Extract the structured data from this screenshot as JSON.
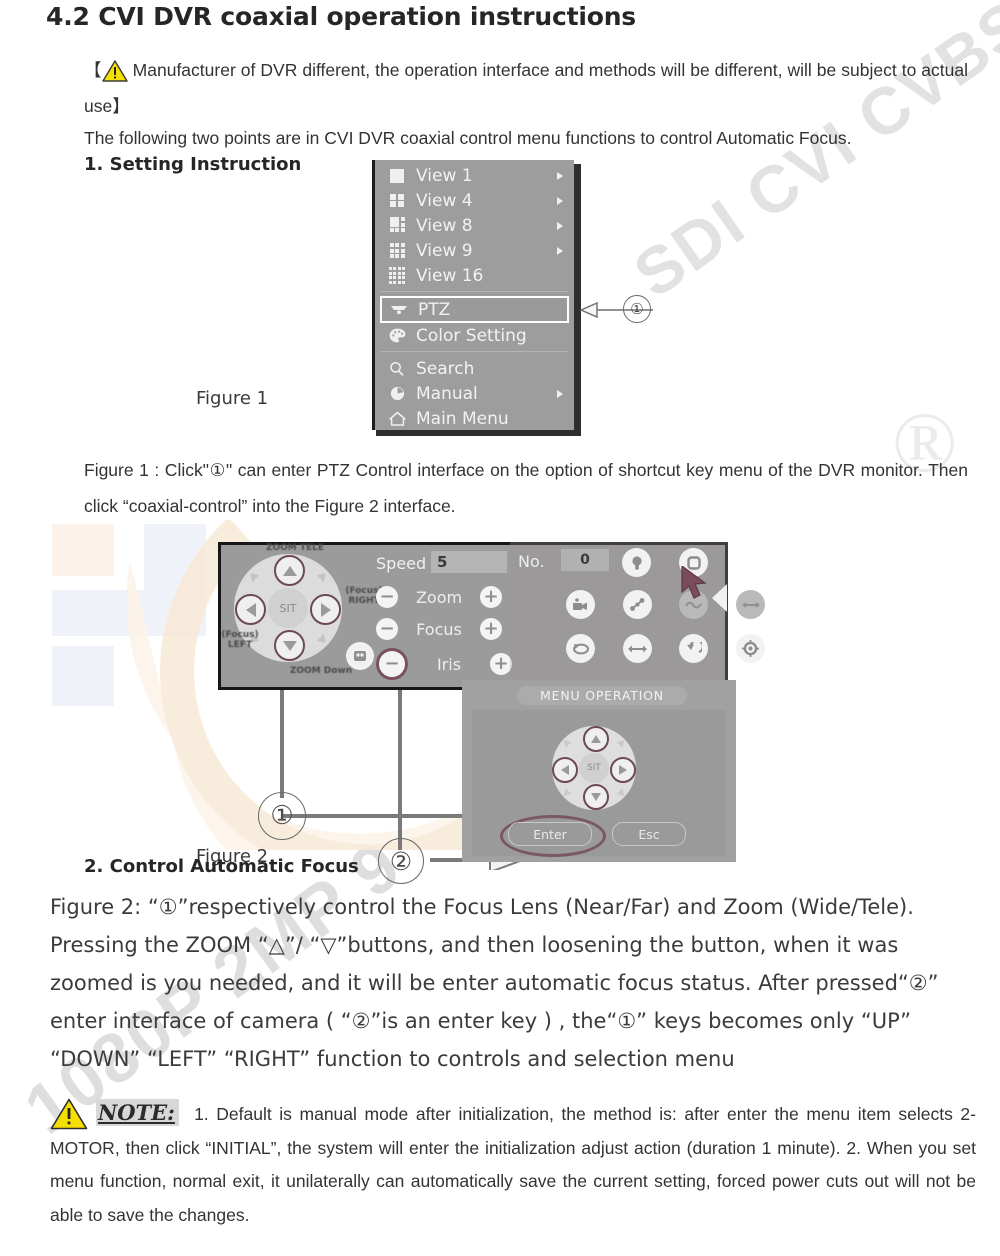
{
  "document": {
    "title": "4.2 CVI DVR coaxial operation instructions",
    "warning_note": "Manufacturer of DVR different,   the operation interface and methods will be different, will be subject to actual use",
    "warning_bracket_open": "【",
    "warning_bracket_close": "】",
    "intro": "The following two points are in CVI DVR coaxial control menu functions to control Automatic Focus.",
    "section_1_heading": "1.  Setting Instruction",
    "section_2_heading": "2.  Control Automatic Focus",
    "figure1_caption": "Figure 1",
    "figure2_caption": "Figure 2",
    "figure1_description": "Figure 1 : Click\"①\" can enter PTZ Control interface on the option of shortcut key menu of the DVR monitor. Then click “coaxial-control” into the Figure 2 interface.",
    "body_paragraph": "Figure 2:  “①”respectively control the Focus Lens (Near/Far) and Zoom (Wide/Tele). Pressing the ZOOM “△”/ “▽”buttons, and then loosening the button, when it was zoomed is you needed, and it will be enter automatic focus status. After pressed“②” enter interface of camera ( “②”is an enter key ) , the“①” keys becomes only “UP”  “DOWN”  “LEFT”  “RIGHT” function to controls and selection menu",
    "note_label": "NOTE:",
    "note_text": "1. Default is manual mode after initialization, the method is: after enter the menu item selects 2-MOTOR, then click  “INITIAL”, the system will enter the initialization adjust action (duration 1 minute).   2. When you set menu function, normal exit, it unilaterally can automatically save the current setting, forced power cuts out will not be able to save the changes."
  },
  "watermarks": {
    "right_text": "SDI CVI CVBS",
    "left_text": "1080P 2MP 9",
    "registered_mark": "®",
    "color": "#e2e2e2"
  },
  "figure1_menu": {
    "items": [
      {
        "label": "View 1",
        "icon": "view-1-grid-icon",
        "arrow": true,
        "selected": false
      },
      {
        "label": "View 4",
        "icon": "view-4-grid-icon",
        "arrow": true,
        "selected": false
      },
      {
        "label": "View 8",
        "icon": "view-8-grid-icon",
        "arrow": true,
        "selected": false
      },
      {
        "label": "View 9",
        "icon": "view-9-grid-icon",
        "arrow": true,
        "selected": false
      },
      {
        "label": "View 16",
        "icon": "view-16-grid-icon",
        "arrow": false,
        "selected": false
      },
      {
        "label": "PTZ",
        "icon": "dome-camera-icon",
        "arrow": false,
        "selected": true
      },
      {
        "label": "Color Setting",
        "icon": "palette-icon",
        "arrow": false,
        "selected": false
      },
      {
        "label": "Search",
        "icon": "magnifier-icon",
        "arrow": false,
        "selected": false
      },
      {
        "label": "Manual",
        "icon": "record-icon",
        "arrow": true,
        "selected": false
      },
      {
        "label": "Main Menu",
        "icon": "home-icon",
        "arrow": false,
        "selected": false
      }
    ],
    "callout": "①",
    "background_color": "#9d9d9d",
    "text_color": "#f2f2f2"
  },
  "figure2_ptz": {
    "speed_label": "Speed",
    "speed_value": "5",
    "no_label": "No.",
    "no_value": "0",
    "center_label": "SIT",
    "rows": [
      {
        "name": "Zoom",
        "minus": "−",
        "plus": "+"
      },
      {
        "name": "Focus",
        "minus": "−",
        "plus": "+"
      },
      {
        "name": "Iris",
        "minus": "−",
        "plus": "+"
      }
    ],
    "annotations": {
      "zoom_tele": "ZOOM TELE",
      "focus_right": "(Focus) RIGHT",
      "focus_left": "(Focus) LEFT",
      "zoom_down": "ZOOM Down"
    },
    "callout_1": "①",
    "callout_2": "②",
    "panel_color": "#9b9b9b",
    "highlight_color": "#77525c"
  },
  "figure2_menu_operation": {
    "title": "MENU OPERATION",
    "enter_button": "Enter",
    "esc_button": "Esc"
  }
}
